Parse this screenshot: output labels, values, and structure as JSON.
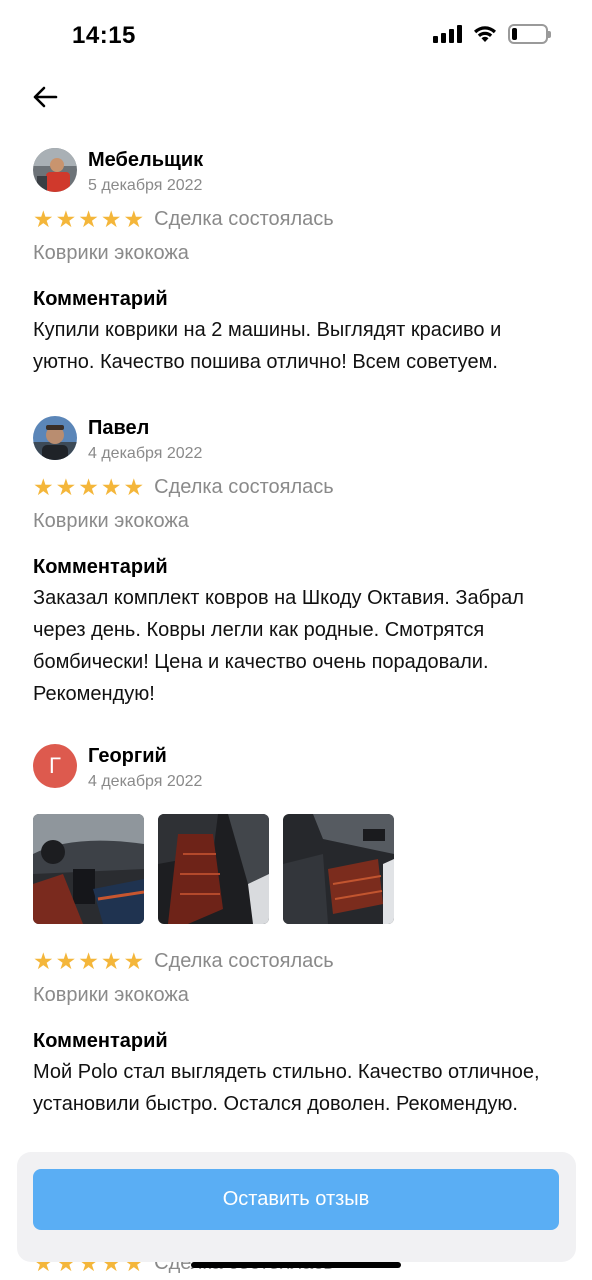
{
  "status_bar": {
    "time": "14:15",
    "battery_level": 0.15
  },
  "reviews": [
    {
      "name": "Мебельщик",
      "date": "5 декабря 2022",
      "rating": 5,
      "deal_status": "Сделка состоялась",
      "product": "Коврики экокожа",
      "comment_title": "Комментарий",
      "comment": "Купили коврики на 2 машины. Выглядят красиво и уютно. Качество пошива отлично! Всем советуем."
    },
    {
      "name": "Павел",
      "date": "4 декабря 2022",
      "rating": 5,
      "deal_status": "Сделка состоялась",
      "product": "Коврики экокожа",
      "comment_title": "Комментарий",
      "comment": "Заказал комплект ковров на Шкоду Октавия. Забрал через день. Ковры легли как родные. Смотрятся бомбически! Цена и качество очень порадовали. Рекомендую!"
    },
    {
      "name": "Георгий",
      "avatar_letter": "Г",
      "date": "4 декабря 2022",
      "rating": 5,
      "deal_status": "Сделка состоялась",
      "product": "Коврики экокожа",
      "comment_title": "Комментарий",
      "comment": "Мой Polo стал выглядеть стильно. Качество отличное, установили быстро. Остался доволен. Рекомендую."
    }
  ],
  "next_review_peek": {
    "deal_status": "Сделка состоялась"
  },
  "cta": {
    "label": "Оставить отзыв"
  },
  "colors": {
    "star": "#f4b63a",
    "cta": "#5aaef4",
    "avatar_letter_bg": "#dd5a4e",
    "muted_text": "#8a8a8a"
  }
}
